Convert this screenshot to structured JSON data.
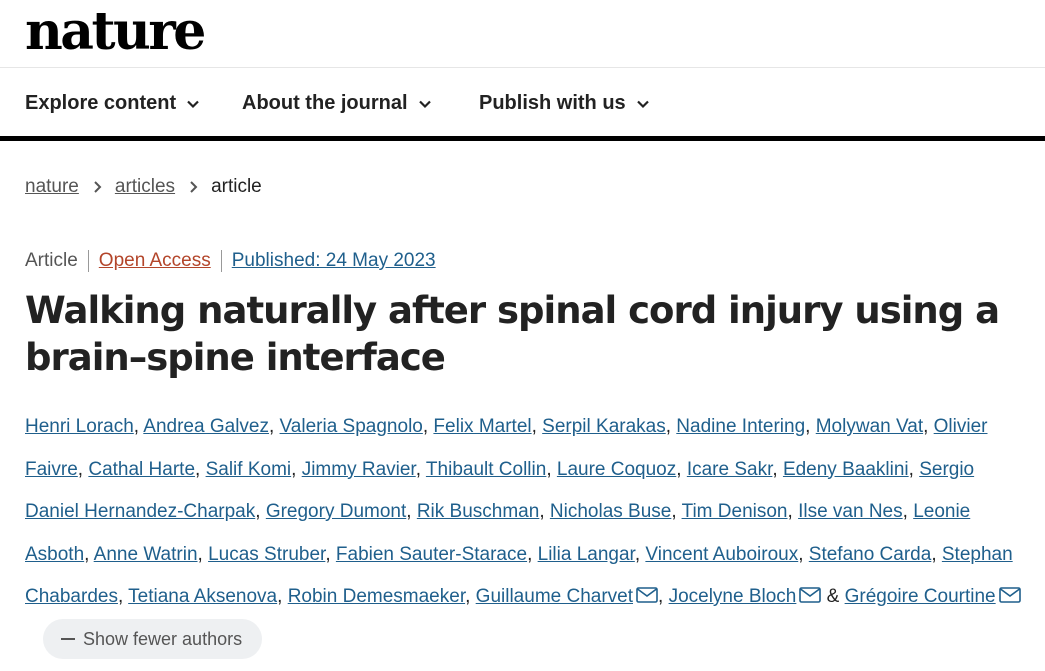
{
  "masthead": {
    "logo_text": "nature"
  },
  "nav": {
    "items": [
      {
        "label": "Explore content"
      },
      {
        "label": "About the journal"
      },
      {
        "label": "Publish with us"
      }
    ]
  },
  "breadcrumb": {
    "items": [
      "nature",
      "articles",
      "article"
    ]
  },
  "article": {
    "type": "Article",
    "access": "Open Access",
    "published": "Published: 24 May 2023",
    "title": "Walking naturally after spinal cord injury using a brain–spine interface"
  },
  "authors": {
    "list": [
      "Henri Lorach",
      "Andrea Galvez",
      "Valeria Spagnolo",
      "Felix Martel",
      "Serpil Karakas",
      "Nadine Intering",
      "Molywan Vat",
      "Olivier Faivre",
      "Cathal Harte",
      "Salif Komi",
      "Jimmy Ravier",
      "Thibault Collin",
      "Laure Coquoz",
      "Icare Sakr",
      "Edeny Baaklini",
      "Sergio Daniel Hernandez-Charpak",
      "Gregory Dumont",
      "Rik Buschman",
      "Nicholas Buse",
      "Tim Denison",
      "Ilse van Nes",
      "Leonie Asboth",
      "Anne Watrin",
      "Lucas Struber",
      "Fabien Sauter-Starace",
      "Lilia Langar",
      "Vincent Auboiroux",
      "Stefano Carda",
      "Stephan Chabardes",
      "Tetiana Aksenova",
      "Robin Demesmaeker",
      "Guillaume Charvet",
      "Jocelyne Bloch",
      "Grégoire Courtine"
    ],
    "corresponding": [
      "Guillaume Charvet",
      "Jocelyne Bloch",
      "Grégoire Courtine"
    ],
    "last_separator": " & ",
    "separator": ", ",
    "toggle_label": "Show fewer authors",
    "colors": {
      "link": "#1f5f8c",
      "open_access": "#b3452a"
    }
  }
}
